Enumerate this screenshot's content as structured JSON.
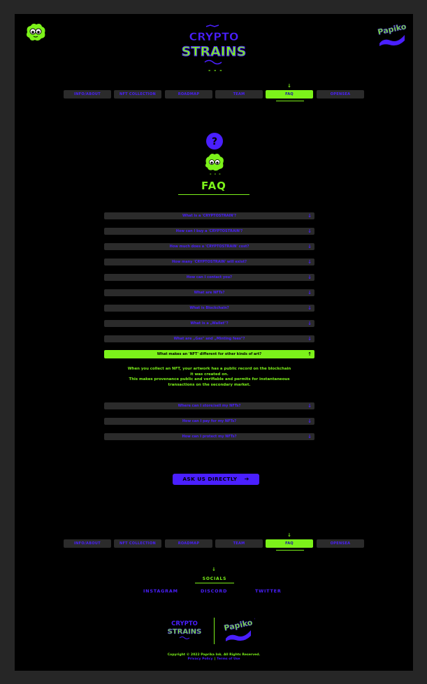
{
  "brand": {
    "logo_top": "CRYPTO",
    "logo_bottom": "STRAINS",
    "partner": "Papiko ink",
    "accent_green": "#7cf21a",
    "accent_blue": "#4a1fff",
    "background": "#000000"
  },
  "nav": {
    "items": [
      {
        "label": "INFO/ABOUT"
      },
      {
        "label": "NFT COLLECTION"
      },
      {
        "label": "ROADMAP"
      },
      {
        "label": "TEAM"
      },
      {
        "label": "FAQ"
      },
      {
        "label": "OPENSEA"
      }
    ],
    "active": "FAQ"
  },
  "faq": {
    "title": "FAQ",
    "hero_icon": "question-mark-icon",
    "items_before": [
      "What is a 'CRYPTOSTRAIN'?",
      "How can I buy a 'CRYPTOSTRAIN'?",
      "How much does a 'CRYPTOSTRAIN' cost?",
      "How many 'CRYPTOSTRAIN' will exist?",
      "How can I contact you?",
      "What are NFTs?",
      "What is Blockchain?",
      "What is a „Wallet\"?",
      "What are „Gas\" and „Minting fees\"?"
    ],
    "open_item": {
      "question": "What makes an 'NFT' different for other kinds of art?",
      "answer_1": "When you collect an NFT, your artwork has a public record on the blockchain",
      "answer_2": "it was created on.",
      "answer_3": "This makes provenance public and verifiable and permits for instantaneous",
      "answer_4": "transactions on the secondary market."
    },
    "items_after": [
      "Where can I store/sell my NFTs?",
      "How can I pay for my NFTs?",
      "How can I protect my NFTs?"
    ]
  },
  "cta": {
    "label": "ASK US DIRECTLY",
    "arrow": "➔"
  },
  "socials": {
    "title": "SOCIALS",
    "links": [
      "INSTAGRAM",
      "DISCORD",
      "TWITTER"
    ]
  },
  "footer": {
    "copyright": "Copyright © 2022 Paprika Ink. All Rights Reserved.",
    "privacy": "Privacy Policy",
    "separator": "|",
    "terms": "Terms of Use"
  },
  "decor": {
    "dashes": "- - -",
    "down_arrow": "↓",
    "up_arrow": "↑"
  }
}
